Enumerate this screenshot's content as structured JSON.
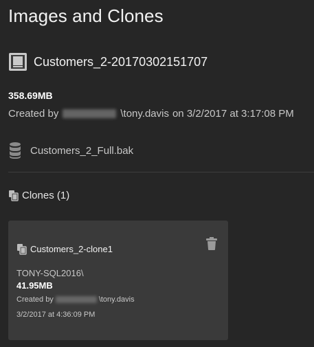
{
  "page": {
    "title": "Images and Clones"
  },
  "image": {
    "icon": "disk-image-icon",
    "name": "Customers_2-20170302151707",
    "size": "358.69MB",
    "created_prefix": "Created by",
    "created_user": "\\tony.davis",
    "created_on": "on 3/2/2017 at 3:17:08 PM",
    "backup_icon": "database-icon",
    "backup_file": "Customers_2_Full.bak"
  },
  "clones": {
    "icon": "copy-icon",
    "heading": "Clones (1)",
    "items": [
      {
        "icon": "copy-icon",
        "name": "Customers_2-clone1",
        "server": "TONY-SQL2016\\",
        "size": "41.95MB",
        "created_prefix": "Created by",
        "created_user": "\\tony.davis",
        "date": "3/2/2017 at 4:36:09 PM",
        "delete_icon": "trash-icon"
      }
    ]
  },
  "colors": {
    "background": "#262626",
    "card": "#3a3a3a",
    "text_primary": "#f2f2f2",
    "text_secondary": "#c8c8c8"
  }
}
